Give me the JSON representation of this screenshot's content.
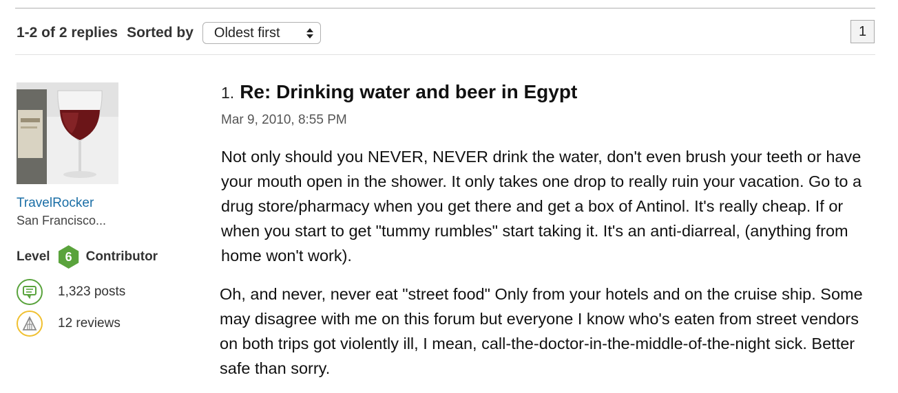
{
  "toolbar": {
    "reply_count": "1-2 of 2 replies",
    "sorted_by_label": "Sorted by",
    "sort_value": "Oldest first",
    "page_number": "1"
  },
  "author": {
    "avatar_icon": "wine-glass-photo",
    "username": "TravelRocker",
    "location": "San Francisco...",
    "level_label": "Level",
    "level_number": "6",
    "level_title": "Contributor",
    "posts": "1,323 posts",
    "reviews": "12 reviews"
  },
  "post": {
    "number": "1.",
    "title": "Re: Drinking water and beer in Egypt",
    "date": "Mar 9, 2010, 8:55 PM",
    "paragraphs": [
      "Not only should you NEVER, NEVER drink the water, don't even brush your teeth or have your mouth open in the shower. It only takes one drop to really ruin your vacation. Go to a drug store/pharmacy when you get there and get a box of Antinol. It's really cheap. If or when you start to get \"tummy rumbles\" start taking it. It's an anti-diarreal, (anything from home won't work).",
      "Oh, and never, never eat \"street food\" Only from your hotels and on the cruise ship. Some may disagree with me on this forum but everyone I know who's eaten from street vendors on both trips got violently ill, I mean, call-the-doctor-in-the-middle-of-the-night sick. Better safe than sorry."
    ]
  },
  "colors": {
    "link": "#1a6ea6",
    "level_badge": "#5aa33c",
    "posts_icon": "#59a33c",
    "reviews_icon": "#f0c030"
  }
}
